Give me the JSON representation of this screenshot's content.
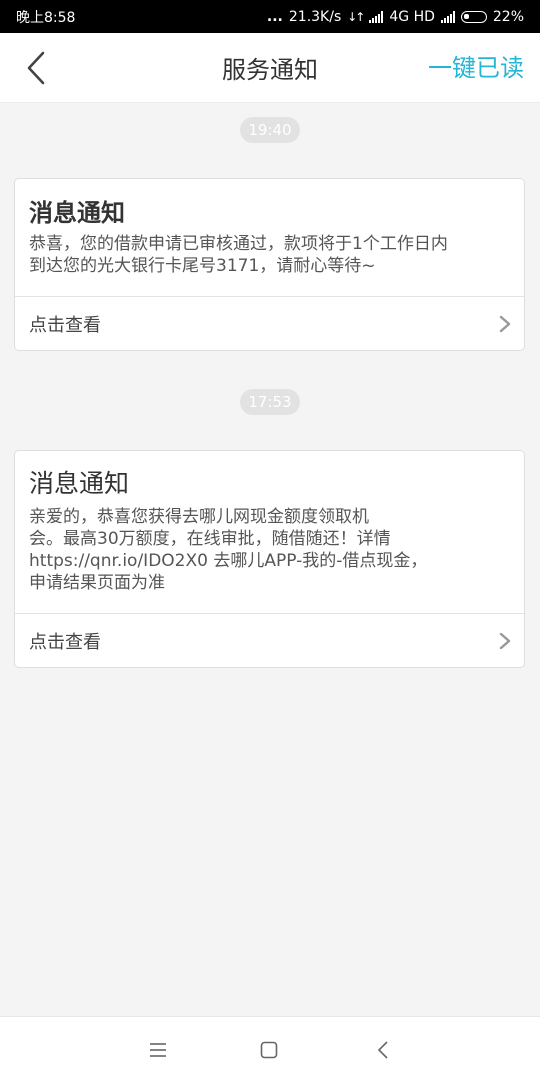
{
  "status_bar": {
    "time": "晚上8:58",
    "dots": "...",
    "speed": "21.3K/s",
    "network": "4G HD",
    "battery": "22%"
  },
  "header": {
    "title": "服务通知",
    "mark_all_read": "一键已读"
  },
  "messages": [
    {
      "time": "19:40",
      "title": "消息通知",
      "lines": [
        "恭喜，您的借款申请已审核通过，款项将于1个工作日内",
        "到达您的光大银行卡尾号3171，请耐心等待~"
      ],
      "action": "点击查看"
    },
    {
      "time": "17:53",
      "title": "消息通知",
      "lines": [
        "亲爱的，恭喜您获得去哪儿网现金额度领取机",
        "会。最高30万额度，在线审批，随借随还！详情",
        "https://qnr.io/IDO2X0 去哪儿APP-我的-借点现金，",
        "申请结果页面为准"
      ],
      "action": "点击查看"
    }
  ],
  "colors": {
    "accent": "#25b6d6",
    "background": "#f4f4f4",
    "status_bar": "#000000"
  },
  "icons": {
    "back": "chevron-left-icon",
    "card_action": "chevron-right-icon",
    "nav": [
      "menu-icon",
      "home-square-icon",
      "back-icon"
    ]
  }
}
